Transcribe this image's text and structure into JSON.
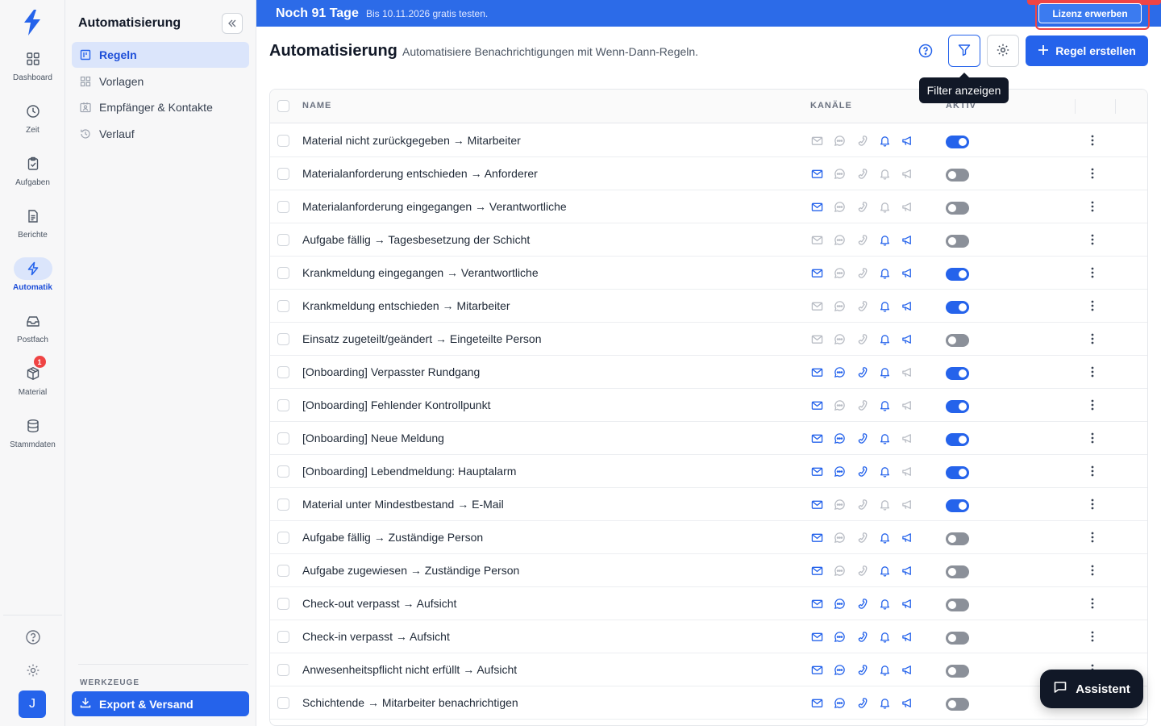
{
  "rail": {
    "items": [
      {
        "label": "Dashboard",
        "icon": "dashboard-icon"
      },
      {
        "label": "Zeit",
        "icon": "clock-icon"
      },
      {
        "label": "Aufgaben",
        "icon": "clipboard-check-icon"
      },
      {
        "label": "Berichte",
        "icon": "document-icon"
      },
      {
        "label": "Automatik",
        "icon": "lightning-icon",
        "active": true
      },
      {
        "label": "Postfach",
        "icon": "inbox-icon"
      },
      {
        "label": "Material",
        "icon": "package-icon",
        "badge": "1"
      },
      {
        "label": "Stammdaten",
        "icon": "database-icon"
      }
    ],
    "avatar_initial": "J"
  },
  "sidebar": {
    "title": "Automatisierung",
    "items": [
      {
        "label": "Regeln",
        "icon": "board-icon",
        "active": true
      },
      {
        "label": "Vorlagen",
        "icon": "grid-icon"
      },
      {
        "label": "Empfänger & Kontakte",
        "icon": "contact-card-icon"
      },
      {
        "label": "Verlauf",
        "icon": "history-icon"
      }
    ],
    "section_label": "WERKZEUGE",
    "export_label": "Export & Versand"
  },
  "banner": {
    "days_left": "Noch 91 Tage",
    "until_text": "Bis 10.11.2026 gratis testen.",
    "license_button": "Lizenz erwerben"
  },
  "header": {
    "title": "Automatisierung",
    "subtitle": "Automatisiere Benachrichtigungen mit Wenn-Dann-Regeln.",
    "create_button": "Regel erstellen",
    "tooltip": "Filter anzeigen"
  },
  "table": {
    "columns": {
      "name": "NAME",
      "channels": "KANÄLE",
      "active": "AKTIV"
    },
    "channel_icons": [
      "mail-icon",
      "chat-icon",
      "phone-icon",
      "bell-icon",
      "megaphone-icon"
    ],
    "rows": [
      {
        "name": "Material nicht zurückgegeben → Mitarbeiter",
        "channels": [
          0,
          0,
          0,
          1,
          1
        ],
        "active": true
      },
      {
        "name": "Materialanforderung entschieden → Anforderer",
        "channels": [
          1,
          0,
          0,
          0,
          0
        ],
        "active": false
      },
      {
        "name": "Materialanforderung eingegangen → Verantwortliche",
        "channels": [
          1,
          0,
          0,
          0,
          0
        ],
        "active": false
      },
      {
        "name": "Aufgabe fällig → Tagesbesetzung der Schicht",
        "channels": [
          0,
          0,
          0,
          1,
          1
        ],
        "active": false
      },
      {
        "name": "Krankmeldung eingegangen → Verantwortliche",
        "channels": [
          1,
          0,
          0,
          1,
          1
        ],
        "active": true
      },
      {
        "name": "Krankmeldung entschieden → Mitarbeiter",
        "channels": [
          0,
          0,
          0,
          1,
          1
        ],
        "active": true
      },
      {
        "name": "Einsatz zugeteilt/geändert → Eingeteilte Person",
        "channels": [
          0,
          0,
          0,
          1,
          1
        ],
        "active": false
      },
      {
        "name": "[Onboarding] Verpasster Rundgang",
        "channels": [
          1,
          1,
          1,
          1,
          0
        ],
        "active": true
      },
      {
        "name": "[Onboarding] Fehlender Kontrollpunkt",
        "channels": [
          1,
          0,
          0,
          1,
          0
        ],
        "active": true
      },
      {
        "name": "[Onboarding] Neue Meldung",
        "channels": [
          1,
          1,
          1,
          1,
          0
        ],
        "active": true
      },
      {
        "name": "[Onboarding] Lebendmeldung: Hauptalarm",
        "channels": [
          1,
          1,
          1,
          1,
          0
        ],
        "active": true
      },
      {
        "name": "Material unter Mindestbestand → E-Mail",
        "channels": [
          1,
          0,
          0,
          0,
          0
        ],
        "active": true
      },
      {
        "name": "Aufgabe fällig → Zuständige Person",
        "channels": [
          1,
          0,
          0,
          1,
          1
        ],
        "active": false
      },
      {
        "name": "Aufgabe zugewiesen → Zuständige Person",
        "channels": [
          1,
          0,
          0,
          1,
          1
        ],
        "active": false
      },
      {
        "name": "Check-out verpasst → Aufsicht",
        "channels": [
          1,
          1,
          1,
          1,
          1
        ],
        "active": false
      },
      {
        "name": "Check-in verpasst → Aufsicht",
        "channels": [
          1,
          1,
          1,
          1,
          1
        ],
        "active": false
      },
      {
        "name": "Anwesenheitspflicht nicht erfüllt → Aufsicht",
        "channels": [
          1,
          1,
          1,
          1,
          1
        ],
        "active": false
      },
      {
        "name": "Schichtende → Mitarbeiter benachrichtigen",
        "channels": [
          1,
          1,
          1,
          1,
          1
        ],
        "active": false
      }
    ]
  },
  "assistant_label": "Assistent",
  "colors": {
    "accent": "#2563eb",
    "banner": "#2c6be8",
    "alert": "#ef4444",
    "dark": "#111827"
  }
}
